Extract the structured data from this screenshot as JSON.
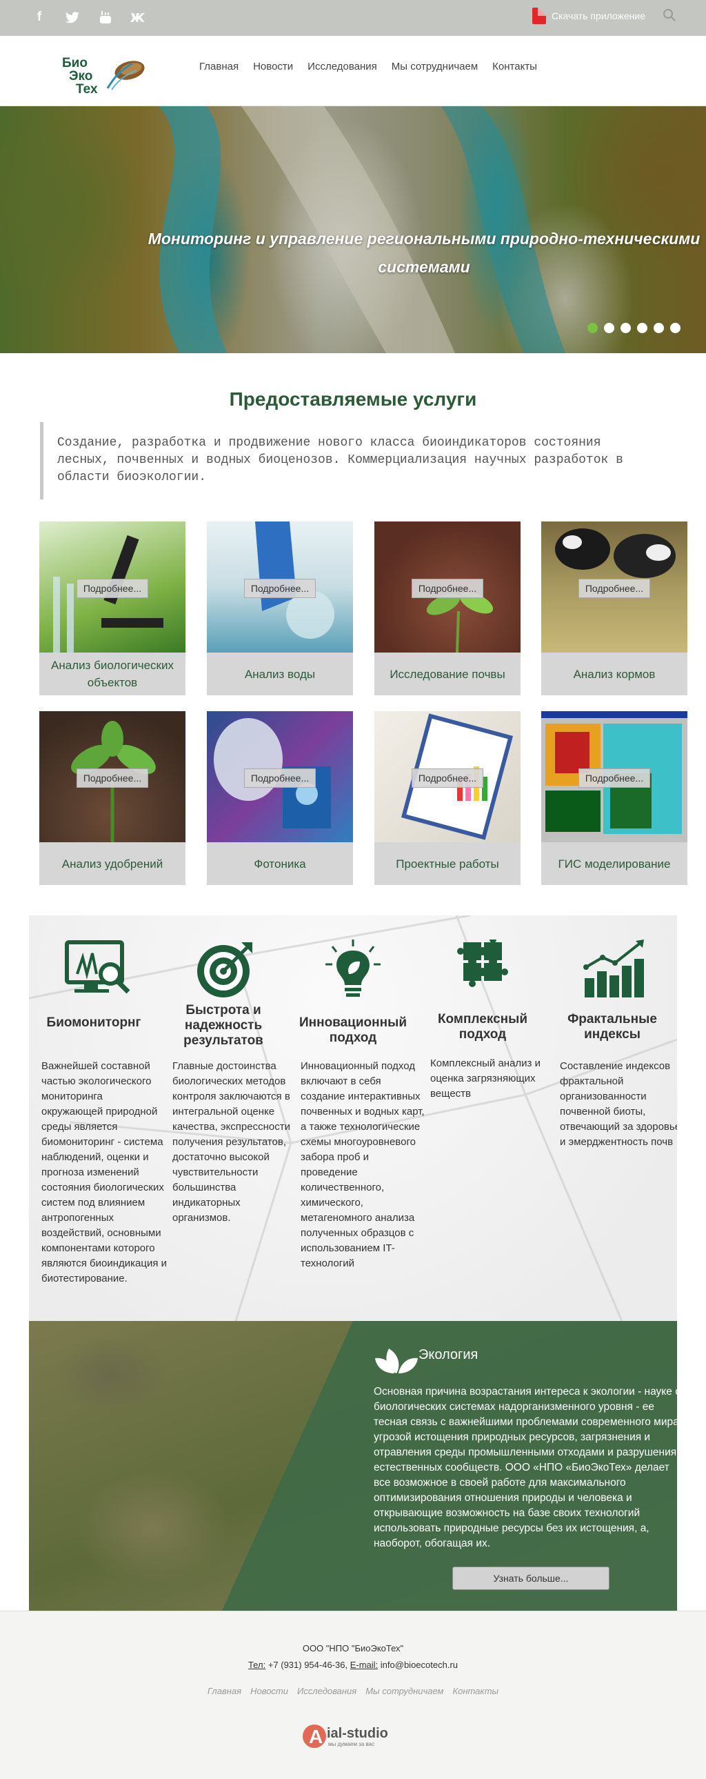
{
  "topbar": {
    "social": [
      {
        "icon": "facebook-icon",
        "glyph": "f"
      },
      {
        "icon": "twitter-icon",
        "glyph": "t"
      },
      {
        "icon": "youtube-icon",
        "glyph": "▶"
      },
      {
        "icon": "vk-icon",
        "glyph": "vk"
      }
    ],
    "app_link": "Скачать приложение"
  },
  "header": {
    "logo_lines": [
      "Био",
      "Эко",
      "Тех"
    ],
    "nav": [
      "Главная",
      "Новости",
      "Исследования",
      "Мы сотрудничаем",
      "Контакты"
    ]
  },
  "hero": {
    "title": "Мониторинг и управление региональными природно-техническими системами",
    "slides": 6,
    "active_slide": 1
  },
  "services": {
    "title": "Предоставляемые услуги",
    "intro": "Создание, разработка и продвижение нового класса биоиндикаторов состояния лесных, почвенных и водных биоценозов. Коммерциализация научных разработок в области биоэкологии.",
    "more_label": "Подробнее...",
    "items": [
      {
        "label": "Анализ биологических объектов"
      },
      {
        "label": "Анализ воды"
      },
      {
        "label": "Исследование почвы"
      },
      {
        "label": "Анализ кормов"
      },
      {
        "label": "Анализ удобрений"
      },
      {
        "label": "Фотоника"
      },
      {
        "label": "Проектные работы"
      },
      {
        "label": "ГИС моделирование"
      }
    ]
  },
  "features": [
    {
      "icon": "monitor-magnifier-icon",
      "title": "Биомониторнг",
      "text": "Важнейшей составной частью экологического мониторинга окружающей природной среды является биомониторинг - система наблюдений, оценки и прогноза изменений состояния биологических систем под влиянием антропогенных воздействий, основными компонентами которого являются биоиндикация и биотестирование."
    },
    {
      "icon": "target-icon",
      "title": "Быстрота и надежность результатов",
      "text": "Главные достоинства биологических методов контроля заключаются в интегральной оценке качества, экспрессности получения результатов, достаточно высокой чувствительности большинства индикаторных организмов."
    },
    {
      "icon": "lightbulb-leaf-icon",
      "title": "Инновационный подход",
      "text": "Инновационный подход включают в себя создание интерактивных почвенных и водных карт, а также технологические схемы многоуровневого забора проб и проведение количественного, химического, метагеномного анализа полученных образцов с использованием IT-технологий"
    },
    {
      "icon": "puzzle-icon",
      "title": "Комплексный подход",
      "text": "Комплексный анализ и оценка загрязняющих веществ"
    },
    {
      "icon": "bar-chart-icon",
      "title": "Фрактальные индексы",
      "text": "Составление индексов фрактальной организованности почвенной биоты, отвечающий за здоровье и эмерджентность почв"
    }
  ],
  "ecology": {
    "title": "Экология",
    "text": "Основная причина возрастания интереса к экологии - науке о биологических системах надорганизменного уровня - ее тесная связь с важнейшими проблемами современного мира: угрозой истощения природных ресурсов, загрязнения и отравления среды промышленными отходами и разрушения естественных сообществ. ООО «НПО «БиоЭкоТех» делает все возможное в своей работе для максимального оптимизирования отношения природы и человека и открывающие возможность на базе своих технологий использовать природные ресурсы без их истощения, а, наоборот, обогащая их.",
    "button": "Узнать больше..."
  },
  "footer": {
    "org": "ООО \"НПО \"БиоЭкоТех\"",
    "phone_label": "Тел:",
    "phone": "+7 (931) 954-46-36,",
    "email_label": "E-mail:",
    "email": "info@bioecotech.ru",
    "nav": [
      "Главная",
      "Новости",
      "Исследования",
      "Мы сотрудничаем",
      "Контакты"
    ],
    "studio_name": "ial-studio",
    "studio_letter": "A",
    "studio_slogan": "мы думаем за вас"
  },
  "colors": {
    "topbar": "#c3c6c1",
    "brand_green": "#2b5a36",
    "icon_green": "#1e5c3a",
    "active_dot": "#7bc242",
    "ecology_panel": "#3f6a47"
  }
}
